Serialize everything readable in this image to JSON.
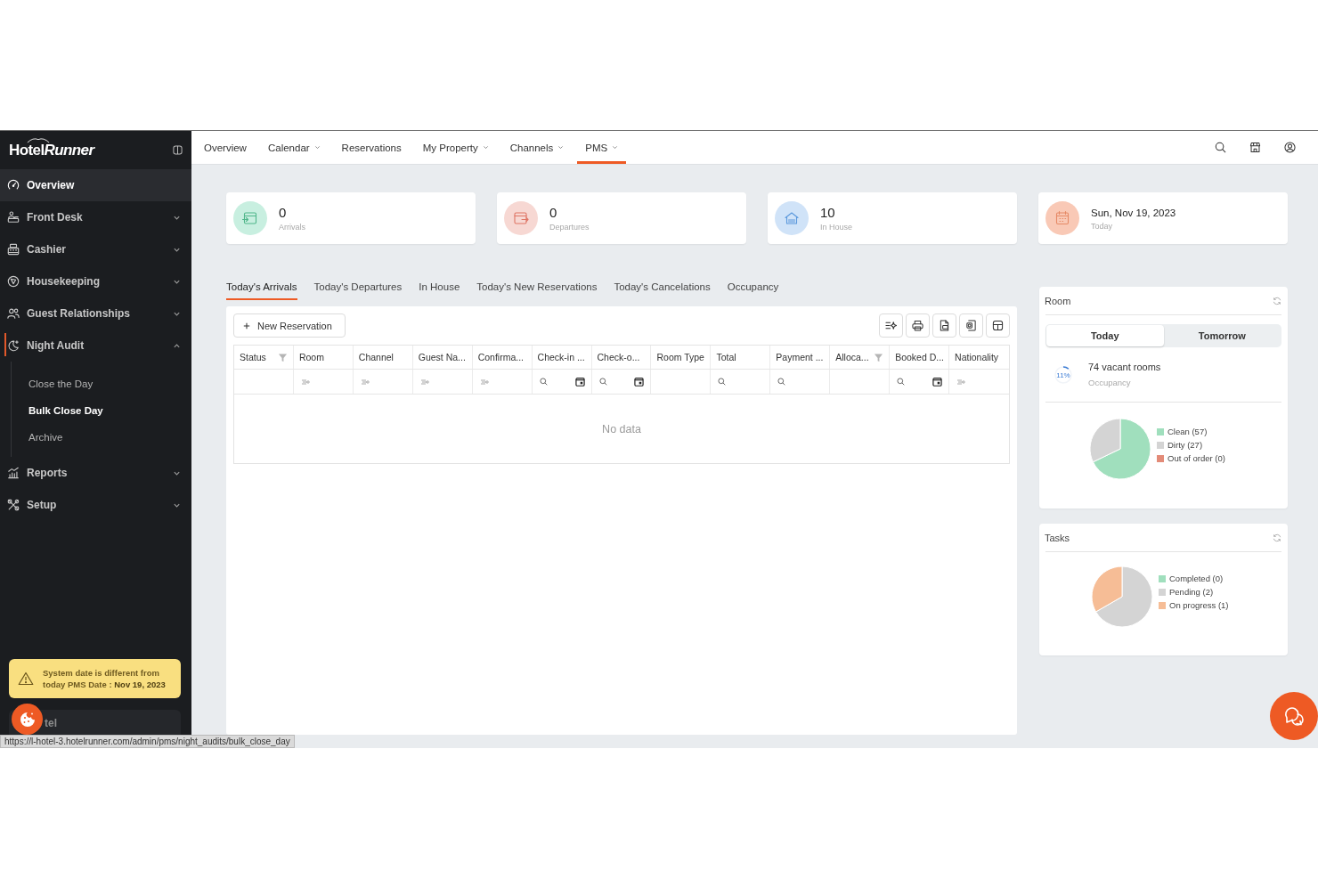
{
  "sidebar": {
    "logo": {
      "text": "Hotel",
      "accent": "Runner"
    },
    "items": [
      {
        "label": "Overview",
        "kind": "link",
        "highlighted": true,
        "selected": false
      },
      {
        "label": "Front Desk",
        "kind": "group",
        "highlighted": false,
        "selected": false,
        "expanded": false
      },
      {
        "label": "Cashier",
        "kind": "group",
        "highlighted": false,
        "selected": false,
        "expanded": false
      },
      {
        "label": "Housekeeping",
        "kind": "group",
        "highlighted": false,
        "selected": false,
        "expanded": false
      },
      {
        "label": "Guest Relationships",
        "kind": "group",
        "highlighted": false,
        "selected": false,
        "expanded": false
      },
      {
        "label": "Night Audit",
        "kind": "group",
        "highlighted": false,
        "selected": true,
        "expanded": true,
        "children": [
          {
            "label": "Close the Day",
            "selected": false
          },
          {
            "label": "Bulk Close Day",
            "selected": true
          },
          {
            "label": "Archive",
            "selected": false
          }
        ]
      },
      {
        "label": "Reports",
        "kind": "group",
        "highlighted": false,
        "selected": false,
        "expanded": false
      },
      {
        "label": "Setup",
        "kind": "group",
        "highlighted": false,
        "selected": false,
        "expanded": false
      }
    ],
    "warning": "System date is different from today PMS Date : **Nov 19, 2023**",
    "hotel_selector": "tel"
  },
  "top_nav": {
    "items": [
      {
        "label": "Overview",
        "dropdown": false,
        "selected": false
      },
      {
        "label": "Calendar",
        "dropdown": true,
        "selected": false
      },
      {
        "label": "Reservations",
        "dropdown": false,
        "selected": false
      },
      {
        "label": "My Property",
        "dropdown": true,
        "selected": false
      },
      {
        "label": "Channels",
        "dropdown": true,
        "selected": false
      },
      {
        "label": "PMS",
        "dropdown": true,
        "selected": true
      }
    ]
  },
  "stat_cards": [
    {
      "kind": "count",
      "value": "0",
      "label": "Arrivals",
      "color": "#c8efe0"
    },
    {
      "kind": "count",
      "value": "0",
      "label": "Departures",
      "color": "#f7d8d3"
    },
    {
      "kind": "count",
      "value": "10",
      "label": "In House",
      "color": "#d0e3f8"
    },
    {
      "kind": "date",
      "value": "Sun, Nov 19, 2023",
      "label": "Today",
      "color": "#f9c9b6"
    }
  ],
  "tabs": [
    {
      "label": "Today's Arrivals",
      "selected": true
    },
    {
      "label": "Today's Departures",
      "selected": false
    },
    {
      "label": "In House",
      "selected": false
    },
    {
      "label": "Today's New Reservations",
      "selected": false
    },
    {
      "label": "Today's Cancelations",
      "selected": false
    },
    {
      "label": "Occupancy",
      "selected": false
    }
  ],
  "toolbar": {
    "new_button": "New Reservation"
  },
  "table": {
    "columns": [
      {
        "label": "Status",
        "header_filter": true,
        "kind": "none"
      },
      {
        "label": "Room",
        "header_filter": false,
        "kind": "list"
      },
      {
        "label": "Channel",
        "header_filter": false,
        "kind": "list"
      },
      {
        "label": "Guest Na...",
        "header_filter": false,
        "kind": "list"
      },
      {
        "label": "Confirma...",
        "header_filter": false,
        "kind": "list"
      },
      {
        "label": "Check-in ...",
        "header_filter": false,
        "kind": "date"
      },
      {
        "label": "Check-o...",
        "header_filter": false,
        "kind": "date"
      },
      {
        "label": "Room Type",
        "header_filter": false,
        "kind": "none"
      },
      {
        "label": "Total",
        "header_filter": false,
        "kind": "search"
      },
      {
        "label": "Payment ...",
        "header_filter": false,
        "kind": "search"
      },
      {
        "label": "Alloca...",
        "header_filter": true,
        "kind": "none"
      },
      {
        "label": "Booked D...",
        "header_filter": false,
        "kind": "date"
      },
      {
        "label": "Nationality",
        "header_filter": false,
        "kind": "list"
      }
    ],
    "empty_text": "No data"
  },
  "room_panel": {
    "title": "Room",
    "segments": [
      {
        "label": "Today",
        "selected": true
      },
      {
        "label": "Tomorrow",
        "selected": false
      }
    ],
    "occupancy": {
      "level": 0.11,
      "reading": "11%",
      "value": "74 vacant rooms",
      "label": "Occupancy"
    },
    "chart_data": {
      "type": "pie",
      "categories": [
        "Clean (57)",
        "Dirty (27)",
        "Out of order (0)"
      ],
      "values": [
        57,
        27,
        0
      ],
      "colors": [
        "#a0dfbd",
        "#d4d4d4",
        "#e38b78"
      ],
      "legend": "right"
    }
  },
  "tasks_panel": {
    "title": "Tasks",
    "chart_data": {
      "type": "pie",
      "categories": [
        "Completed (0)",
        "Pending (2)",
        "On progress (1)"
      ],
      "values": [
        0,
        2,
        1
      ],
      "colors": [
        "#a0dfbd",
        "#d4d4d4",
        "#f6bd96"
      ],
      "legend": "right"
    }
  },
  "status_url": "https://l-hotel-3.hotelrunner.com/admin/pms/night_audits/bulk_close_day"
}
